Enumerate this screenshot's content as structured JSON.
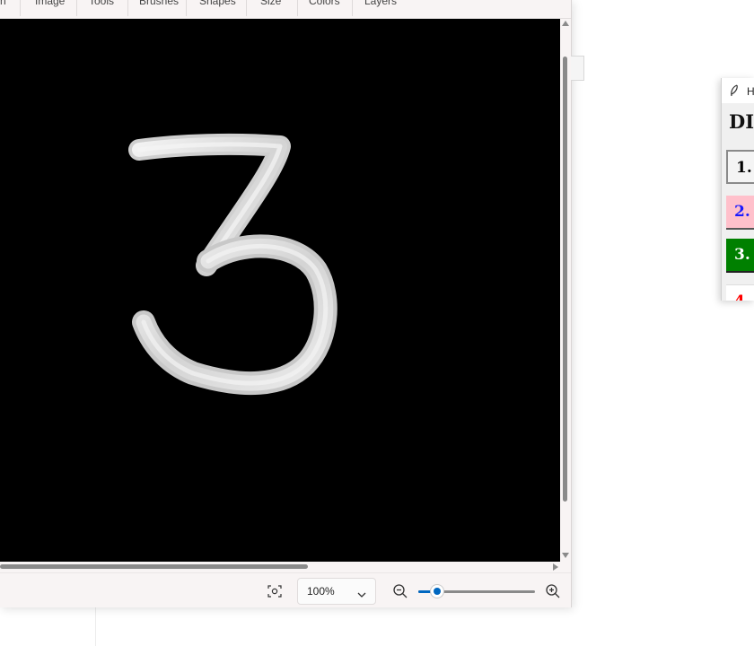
{
  "paint": {
    "menu_tabs": [
      "n",
      "Image",
      "Tools",
      "Brushes",
      "Shapes",
      "Size",
      "Colors",
      "Layers"
    ],
    "canvas": {
      "background": "#000000",
      "drawn_digit": "3",
      "stroke_color": "#e6e6e6"
    },
    "statusbar": {
      "fit_icon": "fit-to-window-icon",
      "zoom_value": "100%",
      "zoom_out_icon": "zoom-out-icon",
      "zoom_in_icon": "zoom-in-icon",
      "zoom_slider_level": 0.15,
      "accent_color": "#0067c0"
    }
  },
  "app2": {
    "title_icon": "feather-icon",
    "title_text": "H",
    "heading": "DIC",
    "buttons": [
      {
        "label": "1.",
        "bg": "#f4f4f4",
        "fg": "#000000"
      },
      {
        "label": "2.",
        "bg": "#ffc0cb",
        "fg": "#1a1aff"
      },
      {
        "label": "3.",
        "bg": "#008000",
        "fg": "#ffffff"
      },
      {
        "label": "4",
        "bg": "#ffffff",
        "fg": "#ff0000"
      }
    ]
  }
}
